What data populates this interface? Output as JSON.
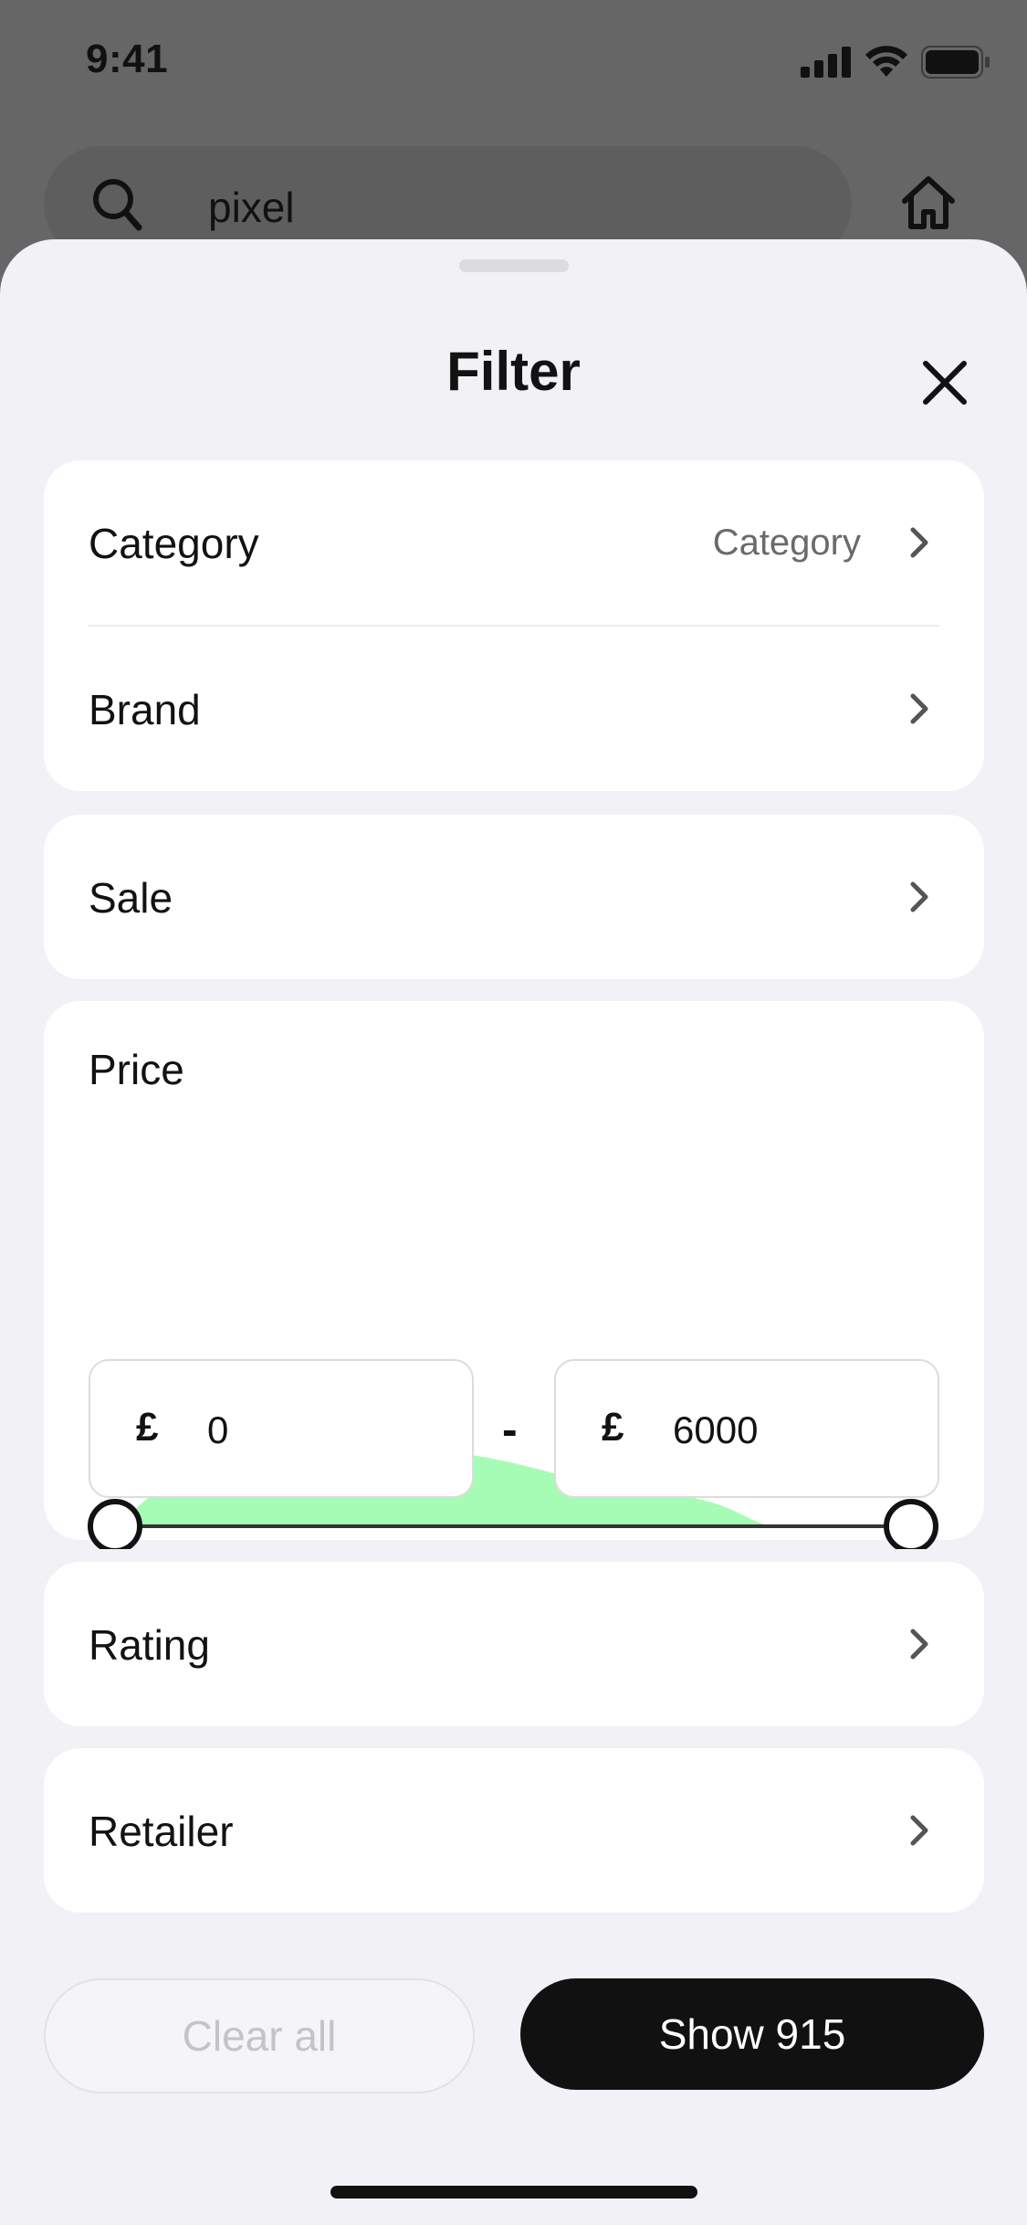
{
  "status_bar": {
    "time": "9:41"
  },
  "search": {
    "query": "pixel"
  },
  "sheet": {
    "title": "Filter",
    "rows": [
      {
        "label": "Category",
        "value": "Category"
      },
      {
        "label": "Brand"
      },
      {
        "label": "Sale"
      },
      {
        "label": "Rating"
      },
      {
        "label": "Retailer"
      }
    ],
    "price": {
      "title": "Price",
      "currency": "£",
      "min": "0",
      "max": "6000",
      "separator": "-",
      "slider_min_fraction": 0,
      "slider_max_fraction": 1
    },
    "clear_label": "Clear all",
    "show_label": "Show 915"
  },
  "colors": {
    "accent_green": "#a6fcb4",
    "button_dark": "#111111",
    "sheet_bg": "#f1f1f6"
  }
}
